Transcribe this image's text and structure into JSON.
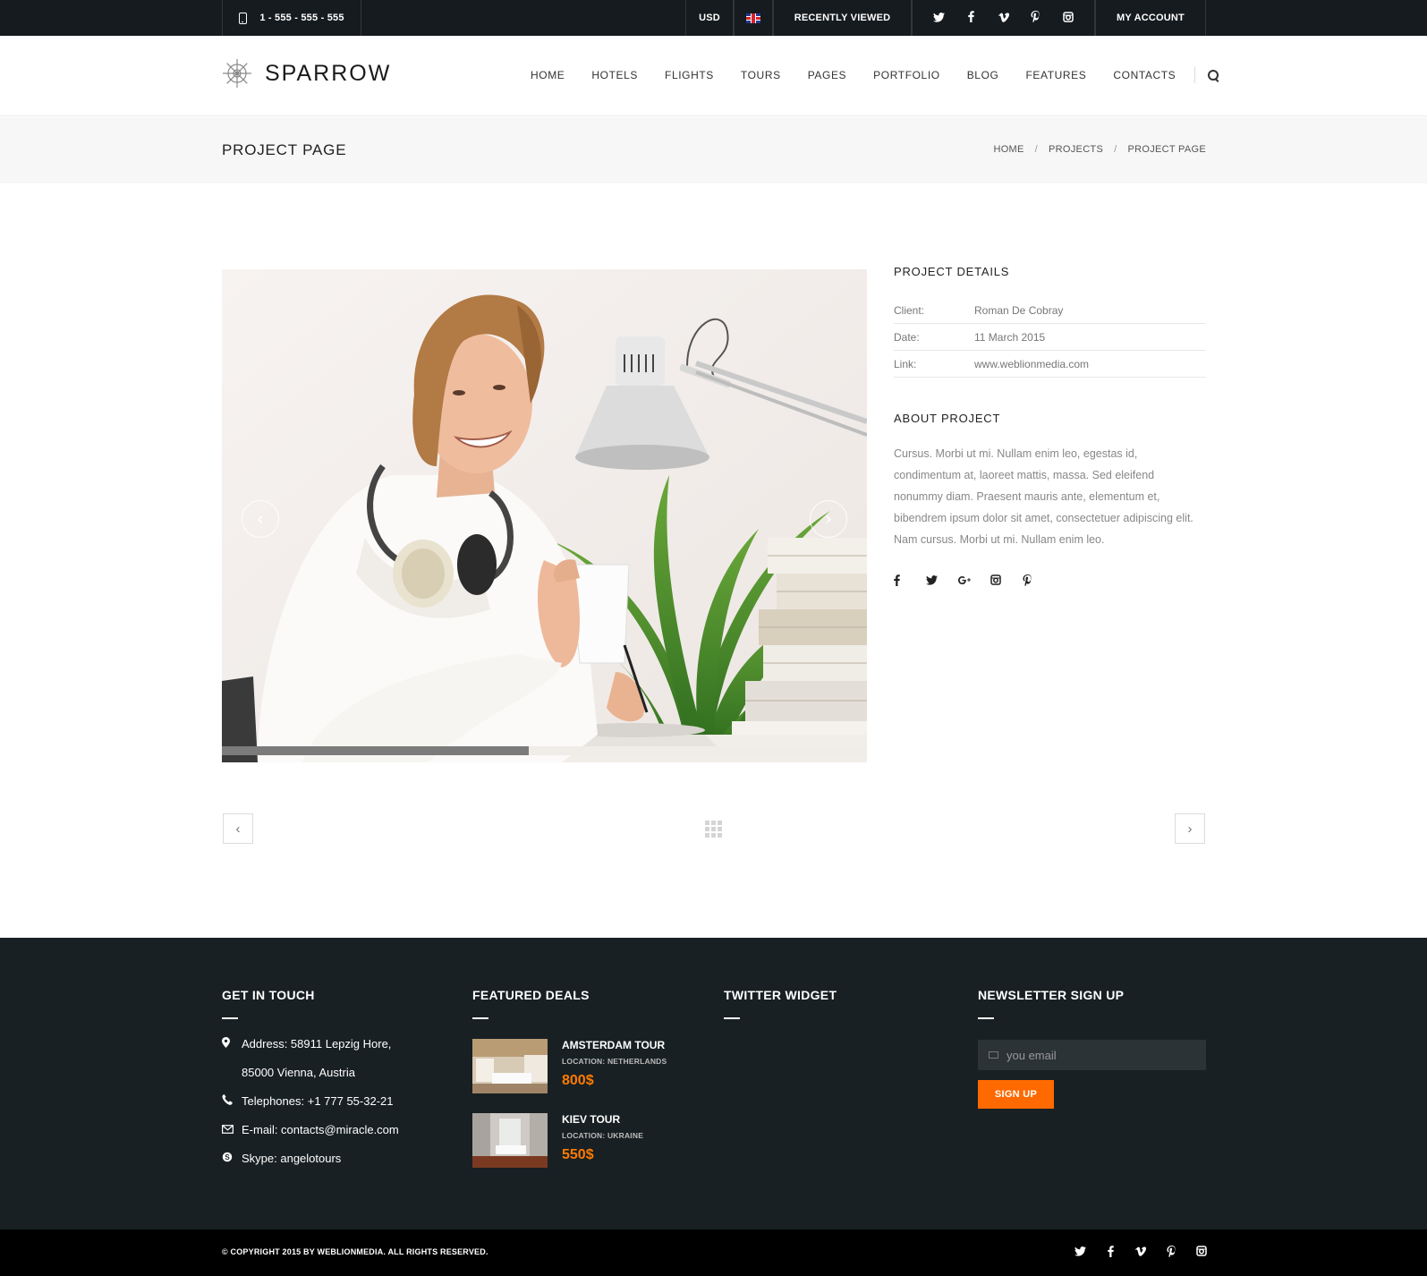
{
  "topbar": {
    "phone": "1 - 555 - 555 - 555",
    "currency": "USD",
    "recently_viewed": "RECENTLY VIEWED",
    "my_account": "MY ACCOUNT",
    "social": [
      "t",
      "f",
      "v",
      "p",
      "◘"
    ]
  },
  "header": {
    "logo": "SPARROW",
    "nav": [
      "HOME",
      "HOTELS",
      "FLIGHTS",
      "TOURS",
      "PAGES",
      "PORTFOLIO",
      "BLOG",
      "FEATURES",
      "CONTACTS"
    ]
  },
  "titlebar": {
    "title": "PROJECT PAGE",
    "breadcrumb": [
      "HOME",
      "PROJECTS",
      "PROJECT PAGE"
    ],
    "separator": "/"
  },
  "slider": {
    "prev": "‹",
    "next": "›"
  },
  "details": {
    "title": "PROJECT DETAILS",
    "rows": [
      {
        "key": "Client:",
        "value": "Roman De Cobray"
      },
      {
        "key": "Date:",
        "value": "11 March 2015"
      },
      {
        "key": "Link:",
        "value": "www.weblionmedia.com"
      }
    ],
    "about_title": "ABOUT PROJECT",
    "about_text": "Cursus. Morbi ut mi. Nullam enim leo, egestas id, condimentum at, laoreet mattis, massa. Sed eleifend nonummy diam. Praesent mauris ante, elementum et, bibendrem ipsum dolor sit amet, consectetuer adipiscing elit. Nam cursus. Morbi ut mi. Nullam enim leo.",
    "social": [
      "f",
      "t",
      "g+",
      "◘",
      "p"
    ]
  },
  "project_nav": {
    "prev": "‹",
    "next": "›"
  },
  "footer": {
    "contact": {
      "title": "GET IN TOUCH",
      "address1": "Address: 58911 Lepzig Hore,",
      "address2": "85000 Vienna, Austria",
      "phone": "Telephones: +1 777 55-32-21",
      "email": "E-mail: contacts@miracle.com",
      "skype": "Skype: angelotours"
    },
    "deals": {
      "title": "FEATURED DEALS",
      "items": [
        {
          "name": "AMSTERDAM TOUR",
          "location": "LOCATION: NETHERLANDS",
          "price": "800$"
        },
        {
          "name": "KIEV TOUR",
          "location": "LOCATION: UKRAINE",
          "price": "550$"
        }
      ]
    },
    "twitter": {
      "title": "TWITTER WIDGET"
    },
    "newsletter": {
      "title": "NEWSLETTER SIGN UP",
      "placeholder": "you email",
      "button": "SIGN UP"
    }
  },
  "bottombar": {
    "copyright": "© COPYRIGHT 2015 BY WEBLIONMEDIA. ALL RIGHTS RESERVED.",
    "social": [
      "t",
      "f",
      "v",
      "p",
      "◘"
    ]
  },
  "colors": {
    "dark": "#161b1f",
    "footer": "#182023",
    "accent": "#ff6a00",
    "price": "#ff7a00"
  }
}
